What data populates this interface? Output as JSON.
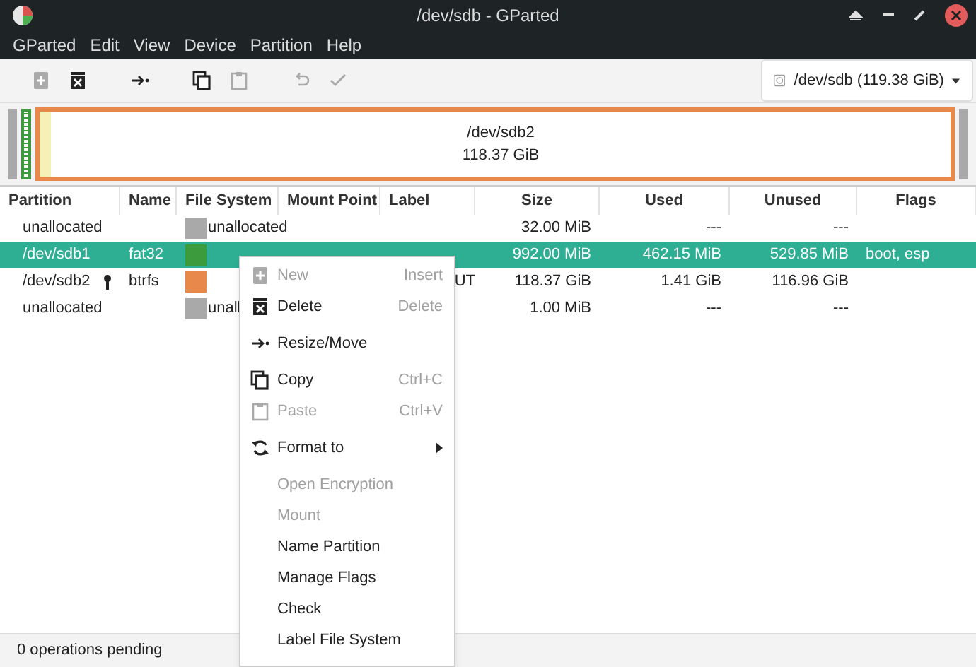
{
  "window": {
    "title": "/dev/sdb - GParted"
  },
  "menubar": [
    "GParted",
    "Edit",
    "View",
    "Device",
    "Partition",
    "Help"
  ],
  "toolbar": [
    {
      "kind": "new",
      "disabled": true
    },
    {
      "kind": "delete",
      "disabled": false
    },
    {
      "kind": "resize",
      "disabled": false
    },
    {
      "kind": "copy",
      "disabled": false
    },
    {
      "kind": "paste",
      "disabled": true
    },
    {
      "kind": "undo",
      "disabled": true
    },
    {
      "kind": "apply",
      "disabled": true
    }
  ],
  "device": "/dev/sdb (119.38 GiB)",
  "disk_map": {
    "name": "/dev/sdb2",
    "size": "118.37 GiB"
  },
  "table": {
    "columns": [
      "Partition",
      "Name",
      "File System",
      "Mount Point",
      "Label",
      "Size",
      "Used",
      "Unused",
      "Flags"
    ],
    "rows": [
      {
        "partition": "unallocated",
        "locked": false,
        "name": "",
        "color": "#a9a9a9",
        "fs": "unallocated",
        "label": "",
        "size": "32.00 MiB",
        "used": "---",
        "unused": "---",
        "flags": "",
        "selected": false
      },
      {
        "partition": "/dev/sdb1",
        "locked": false,
        "name": "fat32",
        "color": "#3c9b3c",
        "fs": "",
        "label": "",
        "size": "992.00 MiB",
        "used": "462.15 MiB",
        "unused": "529.85 MiB",
        "flags": "boot, esp",
        "selected": true
      },
      {
        "partition": "/dev/sdb2",
        "locked": true,
        "name": "btrfs",
        "color": "#e8884a",
        "fs": "",
        "label": "UT",
        "size": "118.37 GiB",
        "used": "1.41 GiB",
        "unused": "116.96 GiB",
        "flags": "",
        "selected": false
      },
      {
        "partition": "unallocated",
        "locked": false,
        "name": "",
        "color": "#a9a9a9",
        "fs": "unall",
        "label": "",
        "size": "1.00 MiB",
        "used": "---",
        "unused": "---",
        "flags": "",
        "selected": false
      }
    ]
  },
  "context_menu": [
    {
      "kind": "new",
      "label": "New",
      "shortcut": "Insert",
      "disabled": true,
      "submenu": false
    },
    {
      "kind": "delete",
      "label": "Delete",
      "shortcut": "Delete",
      "disabled": false,
      "submenu": false
    },
    {
      "kind": "resize",
      "label": "Resize/Move",
      "disabled": false,
      "submenu": false
    },
    {
      "kind": "copy",
      "label": "Copy",
      "shortcut": "Ctrl+C",
      "disabled": false,
      "submenu": false
    },
    {
      "kind": "paste",
      "label": "Paste",
      "shortcut": "Ctrl+V",
      "disabled": true,
      "submenu": false
    },
    {
      "kind": "format",
      "label": "Format to",
      "submenu": true,
      "disabled": false
    },
    {
      "kind": "plain",
      "label": "Open Encryption",
      "disabled": true,
      "submenu": false
    },
    {
      "kind": "plain",
      "label": "Mount",
      "disabled": true,
      "submenu": false
    },
    {
      "kind": "plain",
      "label": "Name Partition",
      "disabled": false,
      "submenu": false
    },
    {
      "kind": "plain",
      "label": "Manage Flags",
      "disabled": false,
      "submenu": false
    },
    {
      "kind": "plain",
      "label": "Check",
      "disabled": false,
      "submenu": false
    },
    {
      "kind": "plain",
      "label": "Label File System",
      "disabled": false,
      "submenu": false
    }
  ],
  "status_bar": "0 operations pending"
}
